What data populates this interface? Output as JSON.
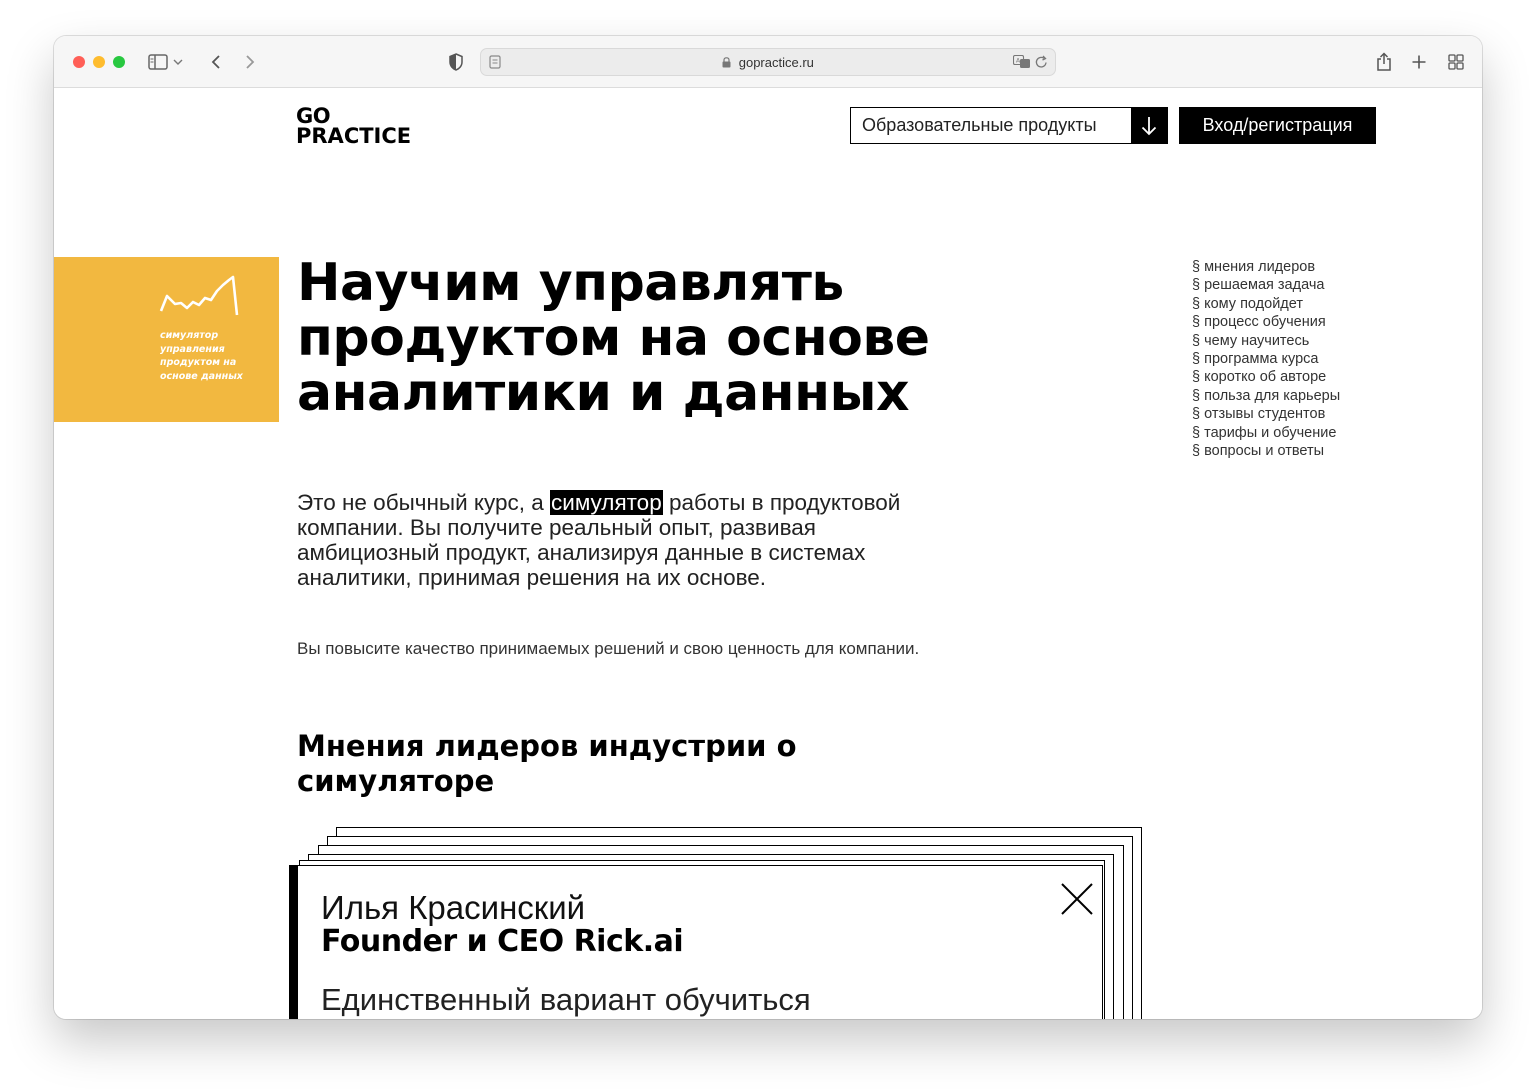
{
  "browser": {
    "url": "gopractice.ru",
    "icons": [
      "sidebar-icon",
      "chevron-down-icon",
      "back-icon",
      "forward-icon",
      "shield-icon",
      "page-icon",
      "lock-icon",
      "translate-icon",
      "reload-icon",
      "share-icon",
      "plus-icon",
      "tabs-grid-icon"
    ]
  },
  "header": {
    "logo_line1": "GO",
    "logo_line2": "PRACTICE",
    "products_label": "Образовательные продукты",
    "login_label": "Вход/регистрация"
  },
  "badge": {
    "caption": "симулятор управления продуктом на основе данных",
    "color": "#f2b840"
  },
  "hero": {
    "title": "Научим управлять продуктом на основе аналитики и данных",
    "lead_before": "Это не обычный курс, а ",
    "lead_highlight": "симулятор",
    "lead_after": " работы в продуктовой компании. Вы получите реальный опыт, развивая амбициозный продукт, анализируя данные в системах аналитики, принимая решения на их основе.",
    "sub": "Вы повысите качество принимаемых решений и свою ценность для компании."
  },
  "toc": [
    "§ мнения лидеров",
    "§ решаемая задача",
    "§ кому подойдет",
    "§ процесс обучения",
    "§ чему научитесь",
    "§ программа курса",
    "§ коротко об авторе",
    "§ польза для карьеры",
    "§ отзывы студентов",
    "§ тарифы и обучение",
    "§ вопросы и ответы"
  ],
  "opinions": {
    "title": "Мнения лидеров индустрии о симуляторе",
    "card": {
      "name": "Илья Красинский",
      "role": "Founder и CEO Rick.ai",
      "quote": "Единственный вариант обучиться"
    }
  }
}
